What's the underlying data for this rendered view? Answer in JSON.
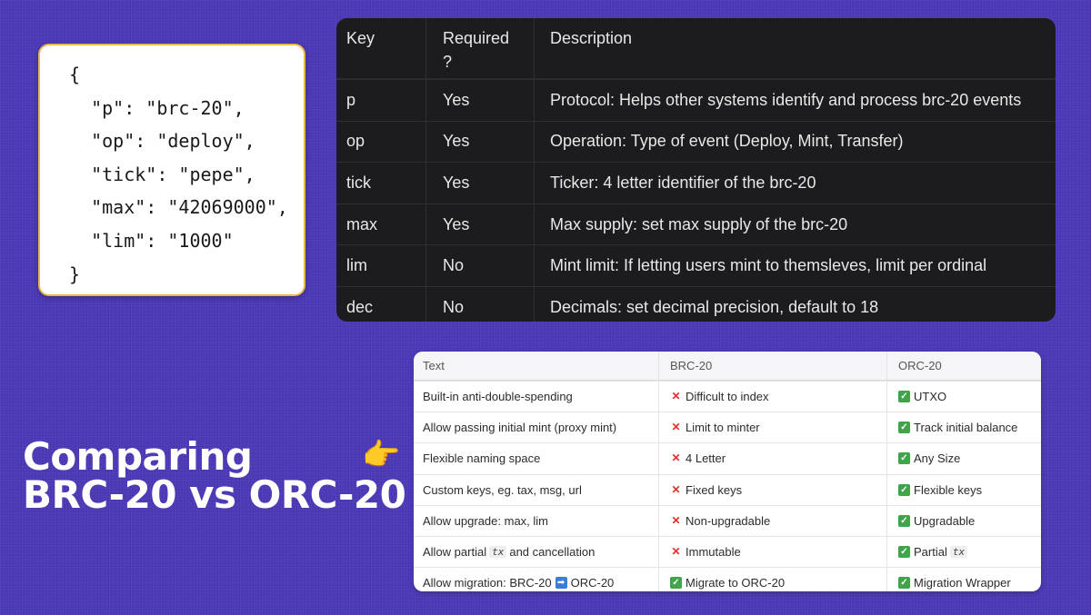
{
  "code_card": {
    "lines": [
      "{",
      "  \"p\": \"brc-20\",",
      "  \"op\": \"deploy\",",
      "  \"tick\": \"pepe\",",
      "  \"max\": \"42069000\",",
      "  \"lim\": \"1000\"",
      "}"
    ]
  },
  "field_table": {
    "headers": [
      "Key",
      "Required\n?",
      "Description"
    ],
    "rows": [
      [
        "p",
        "Yes",
        "Protocol: Helps other systems identify and process brc-20 events"
      ],
      [
        "op",
        "Yes",
        "Operation: Type of event (Deploy, Mint, Transfer)"
      ],
      [
        "tick",
        "Yes",
        "Ticker: 4 letter identifier of the brc-20"
      ],
      [
        "max",
        "Yes",
        "Max supply: set max supply of the brc-20"
      ],
      [
        "lim",
        "No",
        "Mint limit: If letting users mint to themsleves, limit per ordinal"
      ],
      [
        "dec",
        "No",
        "Decimals: set decimal precision, default to 18"
      ]
    ]
  },
  "headline": {
    "line1": "Comparing",
    "line2": "BRC-20 vs ORC-20",
    "pointer_icon": "backhand-index-pointing-right-icon"
  },
  "compare_table": {
    "headers": [
      "Text",
      "BRC-20",
      "ORC-20"
    ],
    "rows": [
      {
        "text": "Built-in anti-double-spending",
        "brc": "Difficult to index",
        "brc_mark": "x",
        "orc": "UTXO",
        "orc_mark": "check"
      },
      {
        "text": "Allow passing initial mint (proxy mint)",
        "brc": "Limit to minter",
        "brc_mark": "x",
        "orc": "Track initial balance",
        "orc_mark": "check"
      },
      {
        "text": "Flexible naming space",
        "brc": "4 Letter",
        "brc_mark": "x",
        "orc": "Any Size",
        "orc_mark": "check"
      },
      {
        "text": "Custom keys, eg. tax, msg, url",
        "brc": "Fixed keys",
        "brc_mark": "x",
        "orc": "Flexible keys",
        "orc_mark": "check"
      },
      {
        "text": "Allow upgrade: max, lim",
        "brc": "Non-upgradable",
        "brc_mark": "x",
        "orc": "Upgradable",
        "orc_mark": "check"
      },
      {
        "text_pre": "Allow partial",
        "text_code": "tx",
        "text_post": "and cancellation",
        "brc": "Immutable",
        "brc_mark": "x",
        "orc": "Partial",
        "orc_code": "tx",
        "orc_mark": "check"
      },
      {
        "text_pre": "Allow migration: BRC-20",
        "text_arrow": "➡",
        "text_post": "ORC-20",
        "brc": "Migrate to ORC-20",
        "brc_mark": "check",
        "orc": "Migration Wrapper",
        "orc_mark": "check"
      }
    ]
  },
  "colors": {
    "background": "#4b39b6",
    "dark_table": "#1c1c1e",
    "card_border": "#e7b94a",
    "cross": "#e0302a",
    "check": "#3fa44a"
  }
}
